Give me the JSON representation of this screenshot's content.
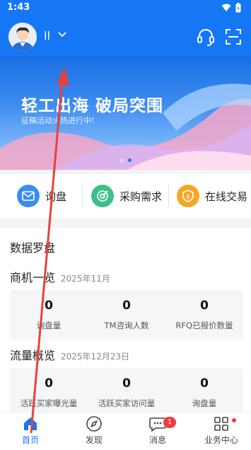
{
  "status": {
    "time": "1:43"
  },
  "header": {
    "username": "ll"
  },
  "banner": {
    "title": "轻工出海 破局突围",
    "subtitle": "征稿活动火热进行中!"
  },
  "quick_actions": [
    {
      "label": "询盘",
      "color": "#3b8cf0",
      "icon": "envelope-icon"
    },
    {
      "label": "采购需求",
      "color": "#3fbf8a",
      "icon": "target-icon"
    },
    {
      "label": "在线交易",
      "color": "#f5a623",
      "icon": "shield-dollar-icon"
    }
  ],
  "data_compass": {
    "title": "数据罗盘"
  },
  "business": {
    "title": "商机一览",
    "date": "2025年11月",
    "stats": [
      {
        "value": "0",
        "label": "询盘量"
      },
      {
        "value": "0",
        "label": "TM咨询人数"
      },
      {
        "value": "0",
        "label": "RFQ已报价数量"
      }
    ]
  },
  "traffic": {
    "title": "流量概览",
    "date": "2025年12月23日",
    "stats": [
      {
        "value": "0",
        "label": "活跃买家曝光量"
      },
      {
        "value": "0",
        "label": "活跃买家访问量"
      },
      {
        "value": "0",
        "label": "询盘量"
      }
    ]
  },
  "tabs": [
    {
      "label": "首页",
      "icon": "home-icon"
    },
    {
      "label": "发现",
      "icon": "compass-icon"
    },
    {
      "label": "消息",
      "icon": "chat-icon",
      "badge": "1"
    },
    {
      "label": "业务中心",
      "icon": "grid-icon"
    }
  ],
  "colors": {
    "primary": "#1677f5",
    "badge": "#f23c3c",
    "arrow": "#e8413b"
  }
}
